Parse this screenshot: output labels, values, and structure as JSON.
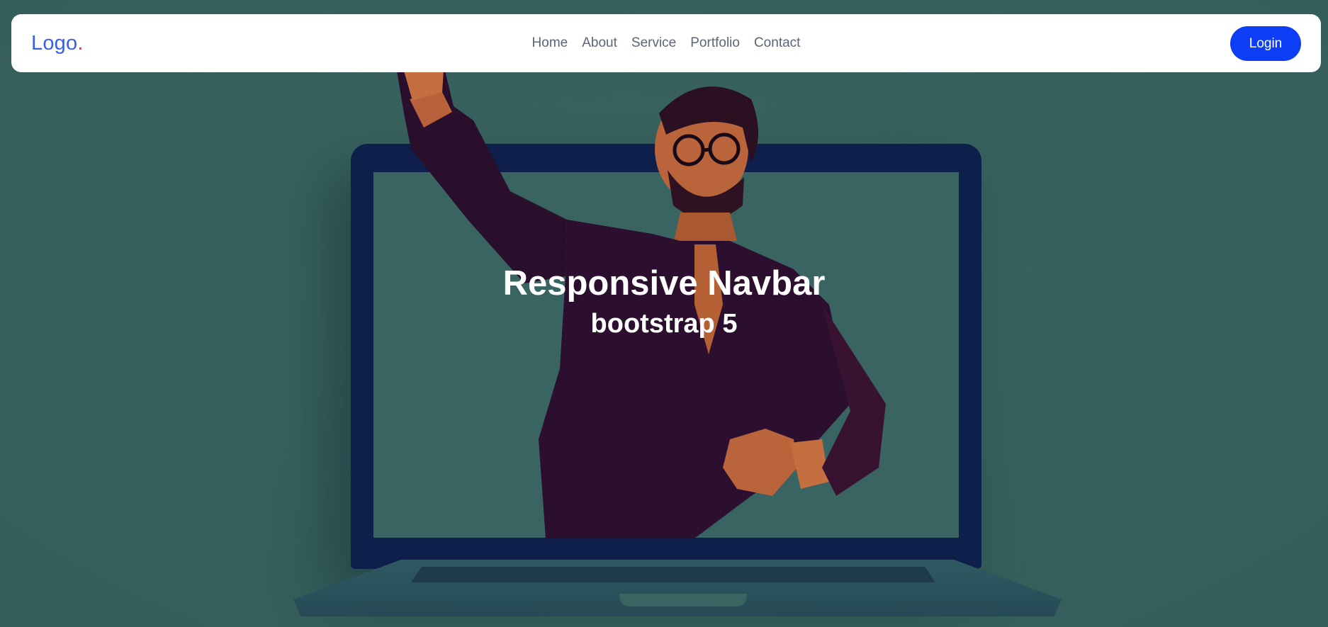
{
  "navbar": {
    "logo_text": "Logo",
    "logo_dot": ".",
    "links": [
      {
        "label": "Home"
      },
      {
        "label": "About"
      },
      {
        "label": "Service"
      },
      {
        "label": "Portfolio"
      },
      {
        "label": "Contact"
      }
    ],
    "login_label": "Login"
  },
  "hero": {
    "title": "Responsive Navbar",
    "subtitle": "bootstrap 5"
  },
  "colors": {
    "background": "#3a6461",
    "accent": "#0d3df5",
    "logo": "#3a5fe0",
    "logo_dot": "#e0334b",
    "nav_text": "#5d6478"
  }
}
